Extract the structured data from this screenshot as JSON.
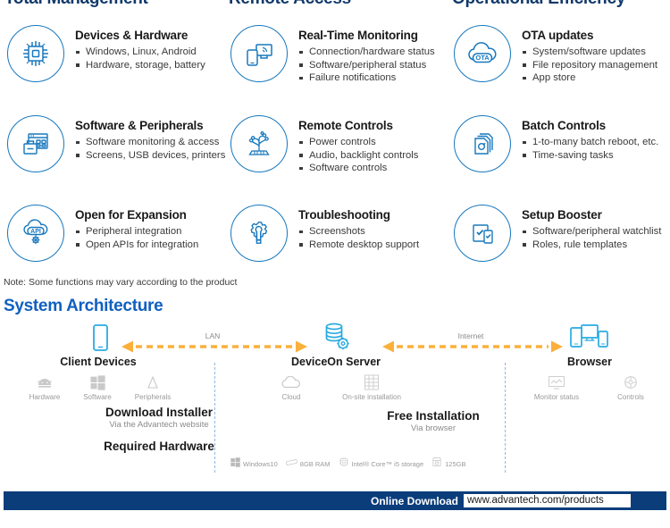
{
  "headers": {
    "col1": "Total Management",
    "col2": "Remote Access",
    "col3": "Operational Efficiency"
  },
  "features": [
    {
      "icon": "chip-icon",
      "title": "Devices & Hardware",
      "items": [
        "Windows, Linux, Android",
        "Hardware, storage, battery"
      ]
    },
    {
      "icon": "monitoring-devices-icon",
      "title": "Real-Time Monitoring",
      "items": [
        "Connection/hardware status",
        "Software/peripheral status",
        "Failure notifications"
      ]
    },
    {
      "icon": "ota-cloud-icon",
      "title": "OTA updates",
      "items": [
        "System/software updates",
        "File repository management",
        "App store"
      ]
    },
    {
      "icon": "software-peripherals-icon",
      "title": "Software & Peripherals",
      "items": [
        "Software monitoring & access",
        "Screens, USB devices, printers"
      ]
    },
    {
      "icon": "remote-controls-circuit-icon",
      "title": "Remote Controls",
      "items": [
        "Power controls",
        "Audio, backlight controls",
        "Software controls"
      ]
    },
    {
      "icon": "batch-documents-icon",
      "title": "Batch Controls",
      "items": [
        "1-to-many batch reboot, etc.",
        "Time-saving tasks"
      ]
    },
    {
      "icon": "api-gear-icon",
      "title": "Open for Expansion",
      "items": [
        "Peripheral integration",
        "Open APIs for integration"
      ]
    },
    {
      "icon": "gear-wrench-icon",
      "title": "Troubleshooting",
      "items": [
        "Screenshots",
        "Remote desktop support"
      ]
    },
    {
      "icon": "setup-checklist-icon",
      "title": "Setup Booster",
      "items": [
        "Software/peripheral watchlist",
        "Roles, rule templates"
      ]
    }
  ],
  "note": "Note: Some functions may vary according to the product",
  "architecture": {
    "title": "System Architecture",
    "links": [
      {
        "label": "LAN"
      },
      {
        "label": "Internet"
      }
    ],
    "nodes": [
      {
        "id": "client-devices",
        "label": "Client Devices",
        "icon": "tablet-icon",
        "sub_icons": [
          {
            "icon": "android-icon",
            "caption": "Hardware"
          },
          {
            "icon": "windows-icon",
            "caption": "Software"
          },
          {
            "icon": "peripherals-icon",
            "caption": "Peripherals"
          }
        ],
        "install_title": "Free Installation",
        "install_subtitle": "Via the Advantech website"
      },
      {
        "id": "deviceon-server",
        "label": "DeviceOn Server",
        "icon": "database-gear-icon",
        "sub_icons": [
          {
            "icon": "cloud-icon",
            "caption": "Cloud"
          },
          {
            "icon": "server-rack-icon",
            "caption": "On-site installation"
          }
        ],
        "install_title": "Download Installer",
        "install_subtitle": "Via the Advantech website",
        "requirements_title": "Required Hardware",
        "requirements": [
          {
            "icon": "windows-icon",
            "caption": "Windows10"
          },
          {
            "icon": "ram-icon",
            "caption": "8GB RAM"
          },
          {
            "icon": "cpu-icon",
            "caption": "Intel® Core™ i5 storage"
          },
          {
            "icon": "storage-icon",
            "caption": "125GB"
          }
        ]
      },
      {
        "id": "browser",
        "label": "Browser",
        "icon": "multi-device-icon",
        "sub_icons": [
          {
            "icon": "monitor-status-icon",
            "caption": "Monitor status"
          },
          {
            "icon": "controls-icon",
            "caption": "Controls"
          }
        ],
        "install_title": "Free Installation",
        "install_subtitle": "Via browser"
      }
    ]
  },
  "footer": {
    "download_label": "Online Download",
    "url": "www.advantech.com/products"
  },
  "colors": {
    "header_blue": "#123a6b",
    "accent_blue": "#1878be",
    "sa_title_blue": "#1060c0",
    "bar_blue": "#0b3d7b",
    "arrow_yellow": "#fbb03b"
  }
}
